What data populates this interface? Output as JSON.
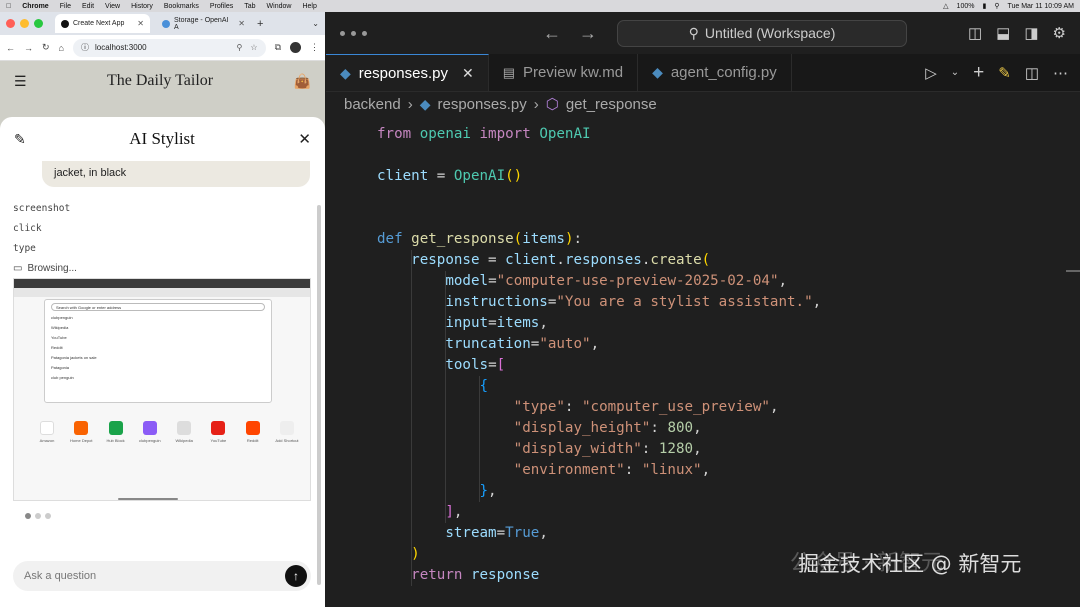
{
  "menubar": {
    "app": "Chrome",
    "items": [
      "File",
      "Edit",
      "View",
      "History",
      "Bookmarks",
      "Profiles",
      "Tab",
      "Window",
      "Help"
    ],
    "battery": "100%",
    "datetime": "Tue Mar 11  10:09 AM"
  },
  "chrome": {
    "tabs": [
      {
        "title": "Create Next App"
      },
      {
        "title": "Storage - OpenAI A"
      }
    ],
    "url": "localhost:3000",
    "site_title": "The Daily Tailor",
    "stylist": {
      "title": "AI Stylist",
      "bubble_text": "jacket, in black",
      "actions": [
        "screenshot",
        "click",
        "type"
      ],
      "browsing": "Browsing...",
      "ask_placeholder": "Ask a question"
    },
    "screenshot_preview": {
      "search_placeholder": "Search with Google or enter address",
      "suggestions": [
        "clubpenguin",
        "Wikipedia",
        "YouTube",
        "Reddit"
      ],
      "recent": [
        "Patagonia jackets on sale",
        "Patagonia",
        "club penguin"
      ],
      "tiles": [
        "Amazon",
        "Home Depot",
        "Hub Block",
        "clubpenguin",
        "Wikipedia",
        "YouTube",
        "Reddit",
        "Add Shortcut"
      ]
    }
  },
  "vscode": {
    "title": "Untitled (Workspace)",
    "tabs": [
      {
        "label": "responses.py"
      },
      {
        "label": "Preview kw.md"
      },
      {
        "label": "agent_config.py"
      }
    ],
    "breadcrumb": [
      "backend",
      "responses.py",
      "get_response"
    ]
  },
  "watermark": "掘金技术社区 @ 新智元",
  "watermark_bg": "公众号 · 新智元"
}
